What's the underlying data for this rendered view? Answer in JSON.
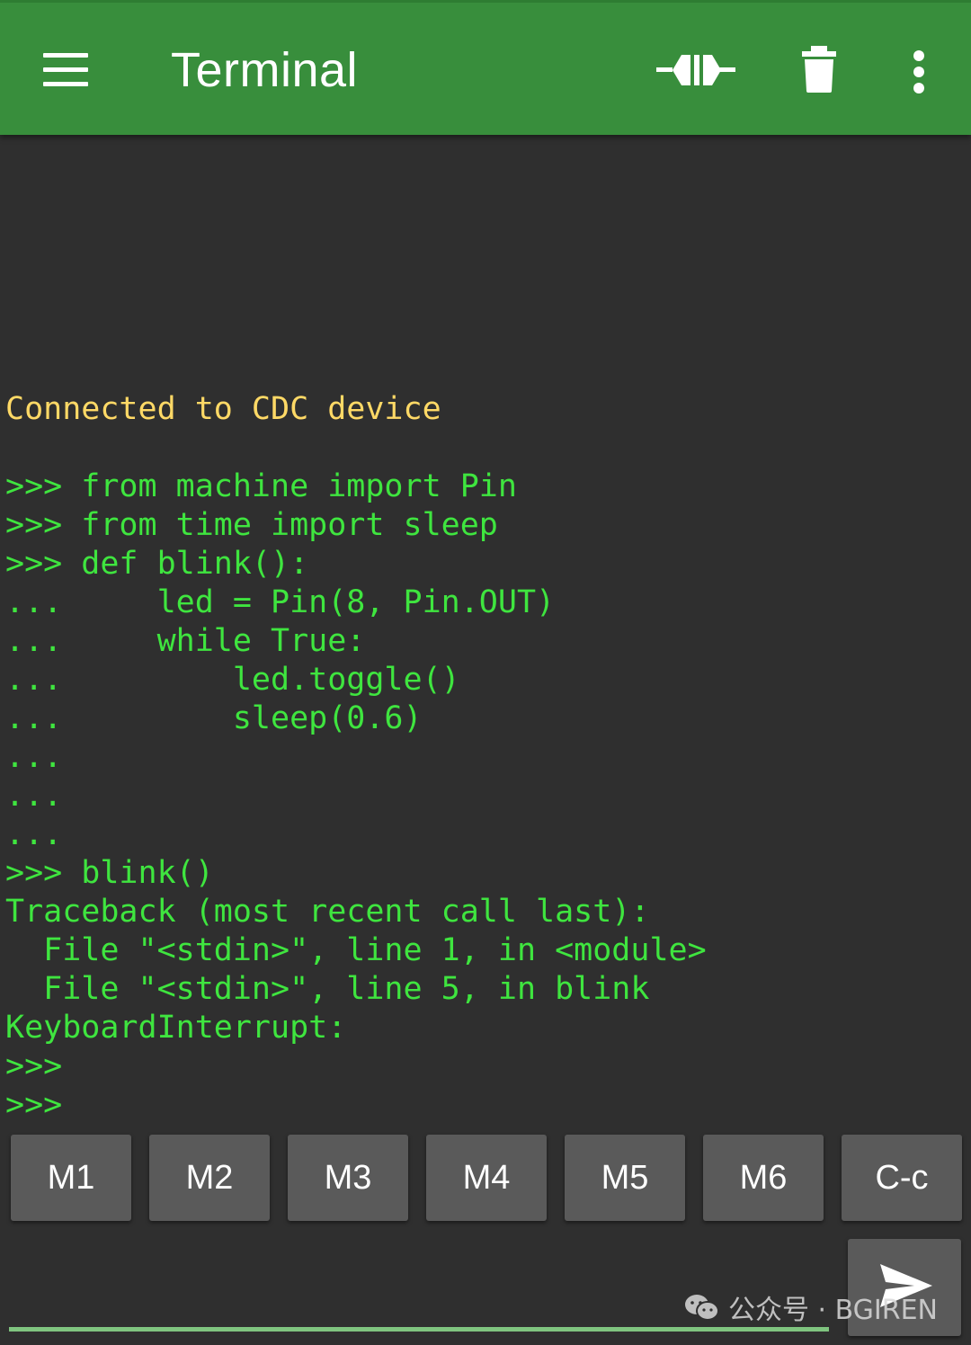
{
  "appbar": {
    "title": "Terminal",
    "icons": {
      "menu": "hamburger-menu-icon",
      "connect": "plug-connect-icon",
      "clear": "trash-icon",
      "more": "more-vert-icon"
    }
  },
  "colors": {
    "appbar": "#388e3c",
    "background": "#2f2f2f",
    "status_text": "#ffd966",
    "terminal_text": "#3fe53f",
    "button": "#5a5a5a",
    "input_underline": "#7fc47f"
  },
  "terminal": {
    "lines": [
      {
        "text": "Connected to CDC device",
        "color": "status"
      },
      {
        "text": "",
        "color": "status"
      },
      {
        "text": ">>> from machine import Pin",
        "color": "output"
      },
      {
        "text": ">>> from time import sleep",
        "color": "output"
      },
      {
        "text": ">>> def blink():",
        "color": "output"
      },
      {
        "text": "...     led = Pin(8, Pin.OUT)",
        "color": "output"
      },
      {
        "text": "...     while True:",
        "color": "output"
      },
      {
        "text": "...         led.toggle()",
        "color": "output"
      },
      {
        "text": "...         sleep(0.6)",
        "color": "output"
      },
      {
        "text": "...",
        "color": "output"
      },
      {
        "text": "...",
        "color": "output"
      },
      {
        "text": "...",
        "color": "output"
      },
      {
        "text": ">>> blink()",
        "color": "output"
      },
      {
        "text": "Traceback (most recent call last):",
        "color": "output"
      },
      {
        "text": "  File \"<stdin>\", line 1, in <module>",
        "color": "output"
      },
      {
        "text": "  File \"<stdin>\", line 5, in blink",
        "color": "output"
      },
      {
        "text": "KeyboardInterrupt:",
        "color": "output"
      },
      {
        "text": ">>>",
        "color": "output"
      },
      {
        "text": ">>>",
        "color": "output"
      }
    ]
  },
  "macros": [
    "M1",
    "M2",
    "M3",
    "M4",
    "M5",
    "M6",
    "C-c"
  ],
  "input": {
    "value": "",
    "placeholder": "",
    "send_icon": "send-icon"
  },
  "watermark": {
    "icon": "wechat-icon",
    "text": "公众号 · BGIREN"
  }
}
